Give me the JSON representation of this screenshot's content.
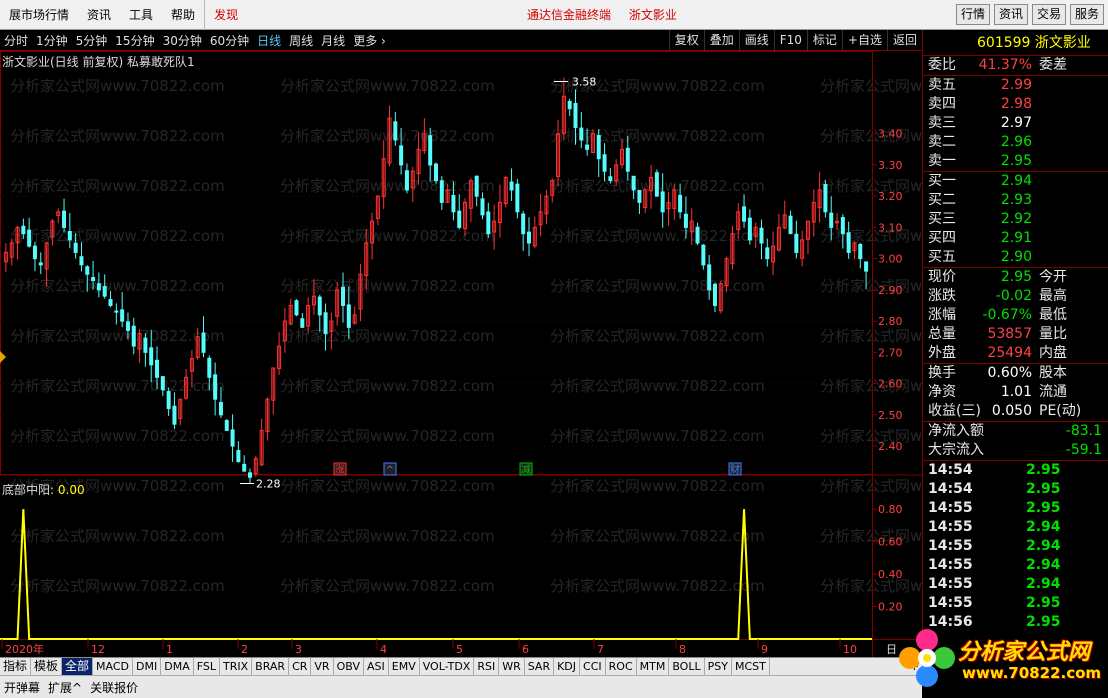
{
  "menu": {
    "items": [
      "展市场行情",
      "资讯",
      "工具",
      "帮助"
    ],
    "highlight": "发现",
    "center_items": [
      "通达信金融终端",
      "浙文影业"
    ],
    "right_buttons": [
      "行情",
      "资讯",
      "交易",
      "服务"
    ]
  },
  "toolbar": {
    "periods": [
      "分时",
      "1分钟",
      "5分钟",
      "15分钟",
      "30分钟",
      "60分钟",
      "日线",
      "周线",
      "月线",
      "更多 ›"
    ],
    "active_period": "日线",
    "actions": [
      "复权",
      "叠加",
      "画线",
      "F10",
      "标记",
      "+自选",
      "返回"
    ]
  },
  "chart": {
    "title": "浙文影业(日线 前复权) 私募敢死队1",
    "high_label": "3.58",
    "low_label": "2.28",
    "price_ticks": [
      "3.40",
      "3.30",
      "3.20",
      "3.10",
      "3.00",
      "2.90",
      "2.80",
      "2.70",
      "2.60",
      "2.50",
      "2.40"
    ],
    "markers": [
      {
        "label": "涨",
        "color": "#ff3030"
      },
      {
        "label": "^",
        "color": "#4080ff"
      },
      {
        "label": "减",
        "color": "#00c000"
      },
      {
        "label": "财",
        "color": "#4080ff"
      }
    ],
    "indicator_title": "底部中阳",
    "indicator_value": ": 0.00",
    "ind_ticks": [
      "0.80",
      "0.60",
      "0.40",
      "0.20"
    ],
    "x_labels": [
      "2020年",
      "12",
      "1",
      "2",
      "3",
      "4",
      "5",
      "6",
      "7",
      "8",
      "9",
      "10"
    ],
    "x_suffix": "日",
    "watermark": "分析家公式网www.70822.com",
    "colors": {
      "up": "#ff3232",
      "down": "#54fcfc",
      "indicator": "#ffff00",
      "grid": "#800000"
    }
  },
  "chart_data": [
    {
      "type": "candlestick",
      "title": "浙文影业(日线 前复权) 私募敢死队1",
      "ylim": [
        2.32,
        3.62
      ],
      "annotations": [
        {
          "label": "3.58",
          "value": 3.58
        },
        {
          "label": "2.28",
          "value": 2.28
        }
      ],
      "close": [
        3.02,
        3.05,
        3.1,
        3.08,
        3.04,
        3.0,
        2.98,
        3.05,
        3.12,
        3.15,
        3.1,
        3.06,
        3.02,
        2.98,
        2.95,
        2.93,
        2.9,
        2.88,
        2.85,
        2.83,
        2.8,
        2.77,
        2.72,
        2.76,
        2.7,
        2.66,
        2.62,
        2.58,
        2.52,
        2.47,
        2.55,
        2.62,
        2.68,
        2.75,
        2.7,
        2.62,
        2.55,
        2.5,
        2.45,
        2.4,
        2.35,
        2.32,
        2.3,
        2.36,
        2.45,
        2.55,
        2.65,
        2.72,
        2.8,
        2.85,
        2.82,
        2.78,
        2.85,
        2.88,
        2.82,
        2.76,
        2.8,
        2.9,
        2.85,
        2.78,
        2.82,
        2.95,
        3.05,
        3.12,
        3.2,
        3.32,
        3.45,
        3.38,
        3.3,
        3.22,
        3.28,
        3.35,
        3.4,
        3.3,
        3.25,
        3.18,
        3.22,
        3.15,
        3.1,
        3.18,
        3.25,
        3.2,
        3.14,
        3.08,
        3.12,
        3.18,
        3.26,
        3.22,
        3.15,
        3.08,
        3.05,
        3.1,
        3.15,
        3.2,
        3.25,
        3.4,
        3.52,
        3.48,
        3.42,
        3.38,
        3.35,
        3.4,
        3.32,
        3.28,
        3.25,
        3.3,
        3.35,
        3.28,
        3.22,
        3.18,
        3.22,
        3.26,
        3.2,
        3.15,
        3.18,
        3.22,
        3.15,
        3.1,
        3.12,
        3.05,
        2.98,
        2.9,
        2.85,
        2.92,
        3.0,
        3.08,
        3.15,
        3.12,
        3.06,
        3.1,
        3.05,
        3.0,
        3.04,
        3.1,
        3.14,
        3.08,
        3.02,
        3.06,
        3.12,
        3.18,
        3.22,
        3.15,
        3.1,
        3.12,
        3.08,
        3.02,
        3.05,
        3.0,
        2.96
      ]
    },
    {
      "type": "line",
      "title": "底部中阳",
      "ylim": [
        0,
        0.9
      ],
      "x": [
        "2020年",
        "12",
        "1",
        "2",
        "3",
        "4",
        "5",
        "6",
        "7",
        "8",
        "9",
        "10"
      ],
      "series": [
        {
          "name": "底部中阳",
          "spikes_at_bar_index": [
            3,
            127
          ],
          "spike_value": 0.8
        }
      ]
    }
  ],
  "panel": {
    "code": "601599",
    "name": "浙文影业",
    "weibi": {
      "label": "委比",
      "value": "41.37%",
      "label2": "委差"
    },
    "asks": [
      {
        "label": "卖五",
        "price": "2.99",
        "cls": "up"
      },
      {
        "label": "卖四",
        "price": "2.98",
        "cls": "up"
      },
      {
        "label": "卖三",
        "price": "2.97",
        "cls": "wh"
      },
      {
        "label": "卖二",
        "price": "2.96",
        "cls": "dn"
      },
      {
        "label": "卖一",
        "price": "2.95",
        "cls": "dn"
      }
    ],
    "bids": [
      {
        "label": "买一",
        "price": "2.94",
        "cls": "dn"
      },
      {
        "label": "买二",
        "price": "2.93",
        "cls": "dn"
      },
      {
        "label": "买三",
        "price": "2.92",
        "cls": "dn"
      },
      {
        "label": "买四",
        "price": "2.91",
        "cls": "dn"
      },
      {
        "label": "买五",
        "price": "2.90",
        "cls": "dn"
      }
    ],
    "stats1": [
      {
        "label": "现价",
        "value": "2.95",
        "cls": "dn",
        "label2": "今开"
      },
      {
        "label": "涨跌",
        "value": "-0.02",
        "cls": "dn",
        "label2": "最高"
      },
      {
        "label": "涨幅",
        "value": "-0.67%",
        "cls": "dn",
        "label2": "最低"
      },
      {
        "label": "总量",
        "value": "53857",
        "cls": "up",
        "label2": "量比"
      },
      {
        "label": "外盘",
        "value": "25494",
        "cls": "up",
        "label2": "内盘"
      }
    ],
    "stats2": [
      {
        "label": "换手",
        "value": "0.60%",
        "cls": "wh",
        "label2": "股本"
      },
      {
        "label": "净资",
        "value": "1.01",
        "cls": "wh",
        "label2": "流通"
      },
      {
        "label": "收益(三)",
        "value": "0.050",
        "cls": "wh",
        "label2": "PE(动)"
      }
    ],
    "flows": [
      {
        "label": "净流入额",
        "value": "-83.1"
      },
      {
        "label": "大宗流入",
        "value": "-59.1"
      }
    ],
    "trades": [
      {
        "time": "14:54",
        "price": "2.95"
      },
      {
        "time": "14:54",
        "price": "2.95"
      },
      {
        "time": "14:55",
        "price": "2.95"
      },
      {
        "time": "14:55",
        "price": "2.94"
      },
      {
        "time": "14:55",
        "price": "2.94"
      },
      {
        "time": "14:55",
        "price": "2.94"
      },
      {
        "time": "14:55",
        "price": "2.94"
      },
      {
        "time": "14:55",
        "price": "2.95"
      },
      {
        "time": "14:56",
        "price": "2.95"
      }
    ]
  },
  "tabs": {
    "items": [
      "指标",
      "模板",
      "全部",
      "MACD",
      "DMI",
      "DMA",
      "FSL",
      "TRIX",
      "BRAR",
      "CR",
      "VR",
      "OBV",
      "ASI",
      "EMV",
      "VOL-TDX",
      "RSI",
      "WR",
      "SAR",
      "KDJ",
      "CCI",
      "ROC",
      "MTM",
      "BOLL",
      "PSY",
      "MCST"
    ],
    "active": "全部",
    "plus": "+"
  },
  "status": {
    "items": [
      "开弹幕",
      "扩展^",
      "关联报价"
    ]
  },
  "logo": {
    "brand": "分析家公式网",
    "url": "www.70822.com"
  }
}
